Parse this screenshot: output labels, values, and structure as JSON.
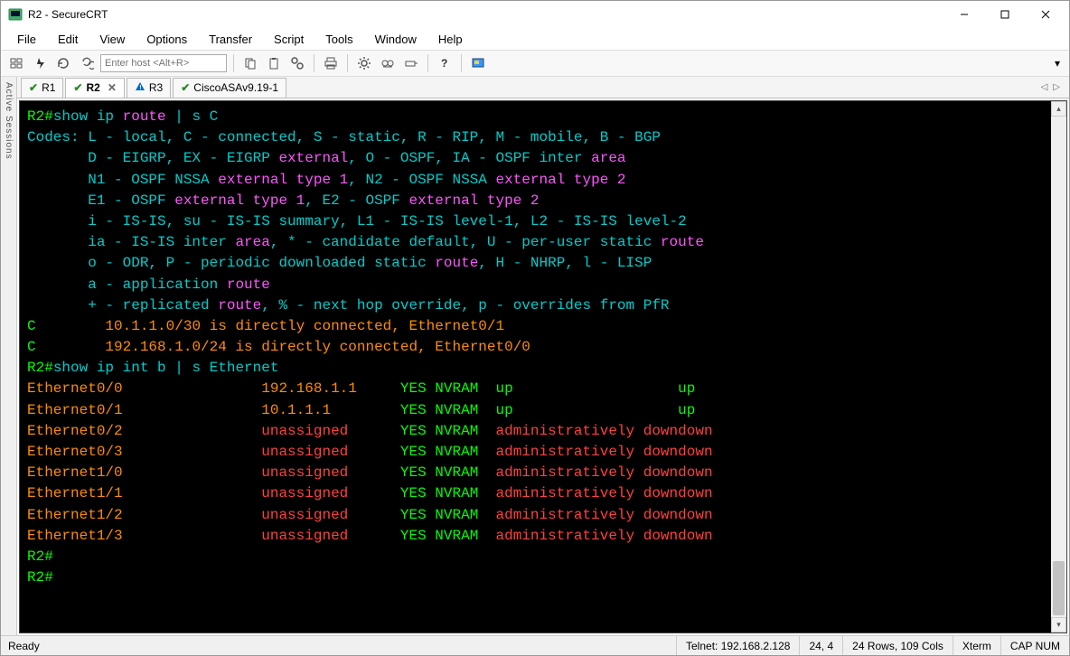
{
  "window": {
    "title": "R2 - SecureCRT"
  },
  "menu": {
    "file": "File",
    "edit": "Edit",
    "view": "View",
    "options": "Options",
    "transfer": "Transfer",
    "script": "Script",
    "tools": "Tools",
    "window": "Window",
    "help": "Help"
  },
  "toolbar": {
    "host_placeholder": "Enter host <Alt+R>"
  },
  "sidebar": {
    "label": "Active Sessions"
  },
  "tabs": [
    {
      "name": "R1",
      "status": "ok",
      "active": false,
      "closable": false
    },
    {
      "name": "R2",
      "status": "ok",
      "active": true,
      "closable": true
    },
    {
      "name": "R3",
      "status": "warn",
      "active": false,
      "closable": false
    },
    {
      "name": "CiscoASAv9.19-1",
      "status": "ok",
      "active": false,
      "closable": false
    }
  ],
  "terminal": {
    "prompt": "R2#",
    "cmd1": {
      "p1": "show ip ",
      "p2": "route",
      "p3": " | s C"
    },
    "codes_line": "Codes: L - local, C - connected, S - static, R - RIP, M - mobile, B - BGP",
    "code_d": {
      "a": "       D - EIGRP, EX - EIGRP ",
      "b": "external",
      "c": ", O - OSPF, IA - OSPF inter ",
      "d": "area"
    },
    "code_n1": {
      "a": "       N1 - OSPF NSSA ",
      "b": "external type 1",
      "c": ", N2 - OSPF NSSA ",
      "d": "external type 2"
    },
    "code_e1": {
      "a": "       E1 - OSPF ",
      "b": "external type 1",
      "c": ", E2 - OSPF ",
      "d": "external type 2"
    },
    "code_i": "       i - IS-IS, su - IS-IS summary, L1 - IS-IS level-1, L2 - IS-IS level-2",
    "code_ia": {
      "a": "       ia - IS-IS inter ",
      "b": "area",
      "c": ", * - candidate default, U - per-user ",
      "d": "static",
      "e": " ",
      "f": "route"
    },
    "code_o": {
      "a": "       o - ODR, P - periodic downloaded ",
      "b": "static",
      "c": " ",
      "d": "route",
      "e": ", H - NHRP, l - LISP"
    },
    "code_a": {
      "a": "       a - application ",
      "b": "route"
    },
    "code_plus": {
      "a": "       + - replicated ",
      "b": "route",
      "c": ", % - next hop override, p - overrides from PfR"
    },
    "route_c1": {
      "c": "C",
      "txt": "        10.1.1.0/30 is directly connected, Ethernet0/1"
    },
    "route_c2": {
      "c": "C",
      "txt": "        192.168.1.0/24 is directly connected, Ethernet0/0"
    },
    "cmd2": "show ip int b | s Ethernet",
    "interfaces": [
      {
        "name": "Ethernet0/0",
        "ip": "192.168.1.1",
        "ok": "YES NVRAM",
        "status": "up",
        "proto": "up",
        "down": false
      },
      {
        "name": "Ethernet0/1",
        "ip": "10.1.1.1",
        "ok": "YES NVRAM",
        "status": "up",
        "proto": "up",
        "down": false
      },
      {
        "name": "Ethernet0/2",
        "ip": "unassigned",
        "ok": "YES NVRAM",
        "status": "administratively down",
        "proto": "down",
        "down": true
      },
      {
        "name": "Ethernet0/3",
        "ip": "unassigned",
        "ok": "YES NVRAM",
        "status": "administratively down",
        "proto": "down",
        "down": true
      },
      {
        "name": "Ethernet1/0",
        "ip": "unassigned",
        "ok": "YES NVRAM",
        "status": "administratively down",
        "proto": "down",
        "down": true
      },
      {
        "name": "Ethernet1/1",
        "ip": "unassigned",
        "ok": "YES NVRAM",
        "status": "administratively down",
        "proto": "down",
        "down": true
      },
      {
        "name": "Ethernet1/2",
        "ip": "unassigned",
        "ok": "YES NVRAM",
        "status": "administratively down",
        "proto": "down",
        "down": true
      },
      {
        "name": "Ethernet1/3",
        "ip": "unassigned",
        "ok": "YES NVRAM",
        "status": "administratively down",
        "proto": "down",
        "down": true
      }
    ]
  },
  "status": {
    "ready": "Ready",
    "conn": "Telnet: 192.168.2.128",
    "cursor": "24,  4",
    "size": "24 Rows, 109 Cols",
    "term": "Xterm",
    "caps": "CAP  NUM"
  }
}
